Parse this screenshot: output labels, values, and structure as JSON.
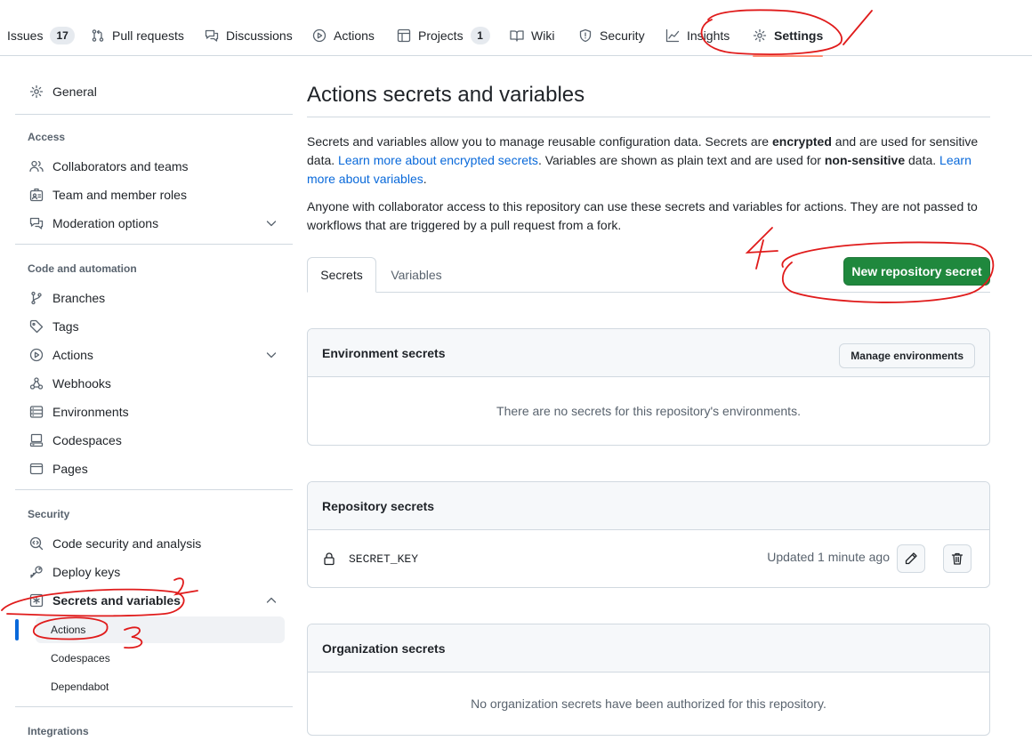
{
  "topnav": {
    "tabs": [
      {
        "label": "Issues",
        "count": "17"
      },
      {
        "label": "Pull requests"
      },
      {
        "label": "Discussions"
      },
      {
        "label": "Actions"
      },
      {
        "label": "Projects",
        "count": "1"
      },
      {
        "label": "Wiki"
      },
      {
        "label": "Security"
      },
      {
        "label": "Insights"
      },
      {
        "label": "Settings",
        "selected": true
      }
    ]
  },
  "sidebar": {
    "general": "General",
    "access": {
      "heading": "Access",
      "items": [
        "Collaborators and teams",
        "Team and member roles",
        "Moderation options"
      ]
    },
    "code_automation": {
      "heading": "Code and automation",
      "items": [
        "Branches",
        "Tags",
        "Actions",
        "Webhooks",
        "Environments",
        "Codespaces",
        "Pages"
      ]
    },
    "security": {
      "heading": "Security",
      "items": [
        "Code security and analysis",
        "Deploy keys",
        "Secrets and variables"
      ],
      "sub_items": [
        "Actions",
        "Codespaces",
        "Dependabot"
      ],
      "active_sub": "Actions"
    },
    "integrations": {
      "heading": "Integrations"
    }
  },
  "main": {
    "title": "Actions secrets and variables",
    "intro": {
      "p1_a": "Secrets and variables allow you to manage reusable configuration data. Secrets are ",
      "p1_b": "encrypted",
      "p1_c": " and are used for sensitive data. ",
      "p1_link1": "Learn more about encrypted secrets",
      "p1_d": ". Variables are shown as plain text and are used for ",
      "p1_e": "non-sensitive",
      "p1_f": " data. ",
      "p1_link2": "Learn more about variables",
      "p1_g": ".",
      "p2": "Anyone with collaborator access to this repository can use these secrets and variables for actions. They are not passed to workflows that are triggered by a pull request from a fork."
    },
    "tabs": [
      "Secrets",
      "Variables"
    ],
    "new_secret_button": "New repository secret",
    "environment_secrets": {
      "title": "Environment secrets",
      "button": "Manage environments",
      "empty": "There are no secrets for this repository's environments."
    },
    "repository_secrets": {
      "title": "Repository secrets",
      "rows": [
        {
          "name": "SECRET_KEY",
          "updated": "Updated 1 minute ago"
        }
      ]
    },
    "organization_secrets": {
      "title": "Organization secrets",
      "empty": "No organization secrets have been authorized for this repository."
    }
  },
  "annotations": [
    "1",
    "2",
    "3",
    "4"
  ],
  "colors": {
    "primary_button": "#1f883d",
    "link": "#0969da",
    "selected_tab_underline": "#fd8c73",
    "annotation_ink": "#e01b1b"
  }
}
